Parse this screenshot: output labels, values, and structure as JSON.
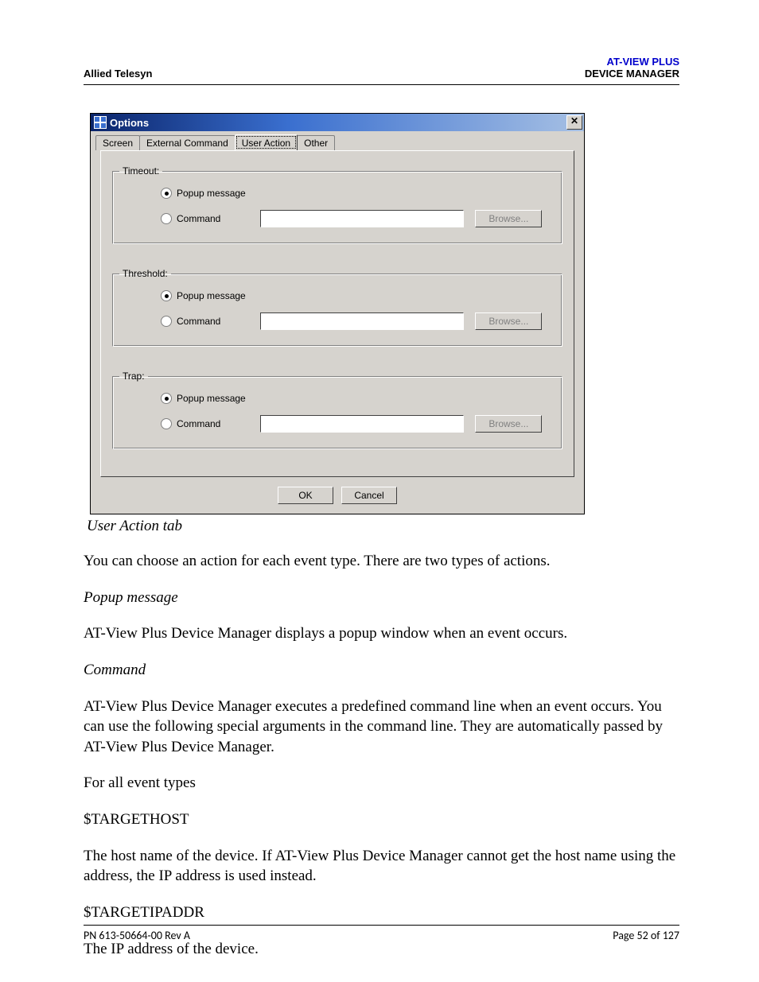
{
  "header": {
    "left": "Allied Telesyn",
    "right_top": "AT-VIEW PLUS",
    "right_bottom": "DEVICE MANAGER"
  },
  "dialog": {
    "title": "Options",
    "close_glyph": "✕",
    "tabs": [
      "Screen",
      "External Command",
      "User Action",
      "Other"
    ],
    "groups": {
      "timeout": {
        "legend": "Timeout:",
        "popup_label": "Popup message",
        "command_label": "Command",
        "browse_label": "Browse...",
        "command_value": ""
      },
      "threshold": {
        "legend": "Threshold:",
        "popup_label": "Popup message",
        "command_label": "Command",
        "browse_label": "Browse...",
        "command_value": ""
      },
      "trap": {
        "legend": "Trap:",
        "popup_label": "Popup message",
        "command_label": "Command",
        "browse_label": "Browse...",
        "command_value": ""
      }
    },
    "ok_label": "OK",
    "cancel_label": "Cancel"
  },
  "caption": "User Action tab",
  "body": {
    "intro": "You can choose an action for each event type. There are two types of actions.",
    "popup_term": "Popup message",
    "popup_desc": "AT-View Plus Device Manager displays a popup window when an event occurs.",
    "command_term": "Command",
    "command_desc": "AT-View Plus Device Manager executes a predefined command line when an event occurs. You can use the following special arguments in the command line. They are automatically passed by AT-View Plus Device Manager.",
    "all_events": "For all event types",
    "arg1": "$TARGETHOST",
    "arg1_desc": "The host name of the device. If AT-View Plus Device Manager cannot get the host name using the address, the IP address is used instead.",
    "arg2": "$TARGETIPADDR",
    "arg2_desc": "The IP address of the device."
  },
  "footer": {
    "left": "PN 613-50664-00 Rev A",
    "right": "Page 52 of 127"
  }
}
